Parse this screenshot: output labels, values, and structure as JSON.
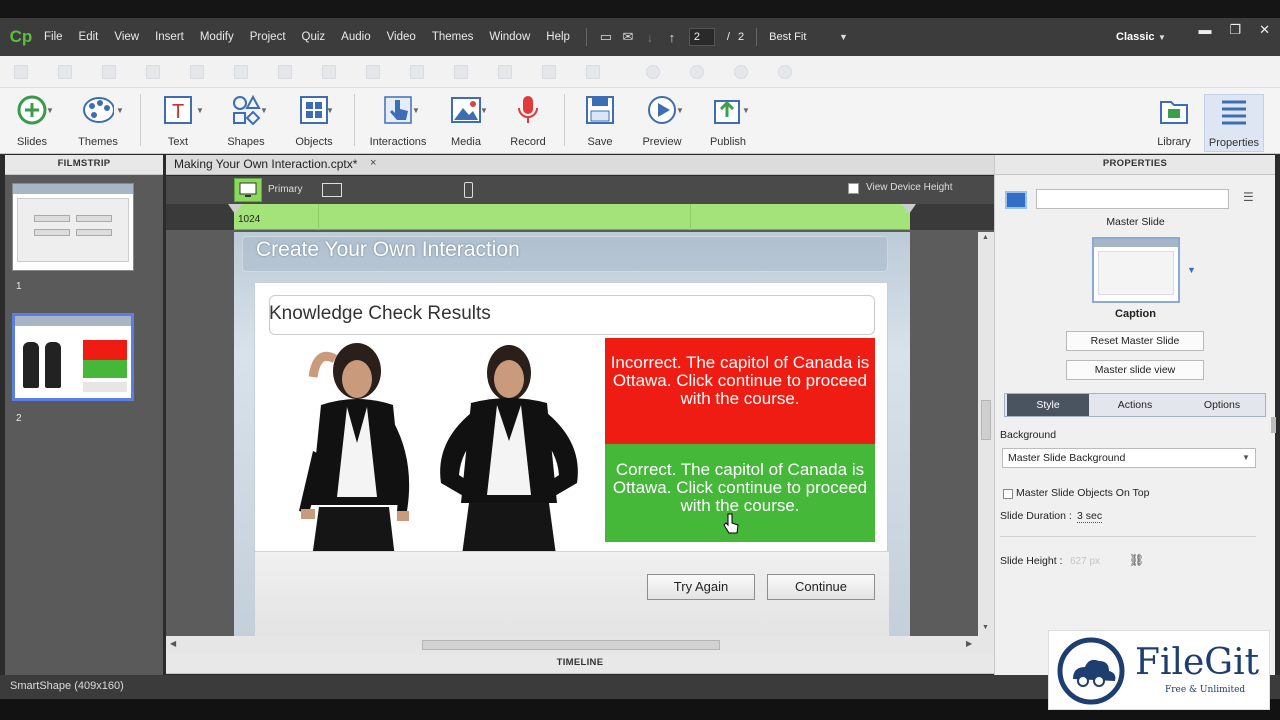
{
  "app": {
    "logo": "Cp",
    "workspace": "Classic"
  },
  "menu": [
    "File",
    "Edit",
    "View",
    "Insert",
    "Modify",
    "Project",
    "Quiz",
    "Audio",
    "Video",
    "Themes",
    "Window",
    "Help"
  ],
  "nav": {
    "current_slide": "2",
    "separator": "/",
    "total_slides": "2",
    "zoom": "Best Fit"
  },
  "toolbar": {
    "slides": "Slides",
    "themes": "Themes",
    "text": "Text",
    "shapes": "Shapes",
    "objects": "Objects",
    "interactions": "Interactions",
    "media": "Media",
    "record": "Record",
    "save": "Save",
    "preview": "Preview",
    "publish": "Publish",
    "library": "Library",
    "properties": "Properties"
  },
  "filmstrip": {
    "header": "FILMSTRIP",
    "slides": [
      {
        "num": "1"
      },
      {
        "num": "2"
      }
    ]
  },
  "doc": {
    "tab_label": "Making Your Own Interaction.cptx*",
    "close": "×"
  },
  "device": {
    "primary_label": "Primary",
    "view_device_height": "View Device Height",
    "width": "1024"
  },
  "slide": {
    "title": "Create Your Own Interaction",
    "kc_title": "Knowledge Check Results",
    "incorrect": "Incorrect. The capitol of Canada is Ottawa. Click continue to proceed with the course.",
    "correct": "Correct. The capitol of Canada is Ottawa. Click continue to proceed with the course.",
    "try_again": "Try Again",
    "continue": "Continue"
  },
  "timeline": {
    "label": "TIMELINE"
  },
  "properties": {
    "header": "PROPERTIES",
    "master_slide_label": "Master Slide",
    "master_name": "Caption",
    "reset_master": "Reset Master Slide",
    "master_view": "Master slide view",
    "tabs": [
      "Style",
      "Actions",
      "Options"
    ],
    "background_label": "Background",
    "background_value": "Master Slide Background",
    "master_on_top": "Master Slide Objects On Top",
    "duration_label": "Slide Duration :",
    "duration_value": "3 sec",
    "height_label": "Slide Height :",
    "height_value": "627 px"
  },
  "status": {
    "text": "SmartShape (409x160)"
  },
  "watermark": {
    "brand": "FileGit",
    "tagline": "Free & Unlimited"
  },
  "colors": {
    "incorrect": "#ee1c12",
    "correct": "#45b83a",
    "device_bar": "#a3e37a",
    "selection": "#5b7fe0"
  }
}
